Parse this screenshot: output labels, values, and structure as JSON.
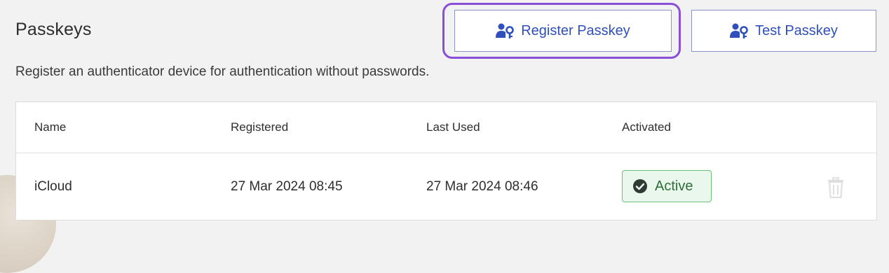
{
  "section": {
    "title": "Passkeys",
    "description": "Register an authenticator device for authentication without passwords."
  },
  "actions": {
    "register_label": "Register Passkey",
    "test_label": "Test Passkey",
    "icon": "user-key-icon"
  },
  "table": {
    "headers": [
      "Name",
      "Registered",
      "Last Used",
      "Activated"
    ],
    "rows": [
      {
        "name": "iCloud",
        "registered": "27 Mar 2024 08:45",
        "last_used": "27 Mar 2024 08:46",
        "status": "Active",
        "status_icon": "check-circle-icon",
        "delete_icon": "trash-icon"
      }
    ]
  },
  "colors": {
    "accent": "#2f4fbd",
    "highlight": "#8a4fd8",
    "active_border": "#6cc07a",
    "active_bg": "#eaf7ec"
  }
}
